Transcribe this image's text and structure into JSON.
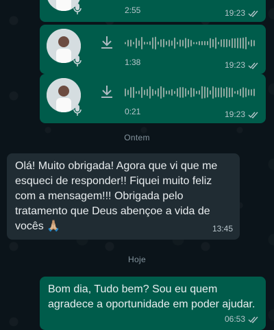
{
  "voice_messages": [
    {
      "duration": "2:55",
      "time": "19:23"
    },
    {
      "duration": "1:38",
      "time": "19:23"
    },
    {
      "duration": "0:21",
      "time": "19:23"
    }
  ],
  "dividers": {
    "yesterday": "Ontem",
    "today": "Hoje"
  },
  "incoming": {
    "text": "Olá! Muito obrigada! Agora que vi que me esqueci de responder!! Fiquei muito feliz com a mensagem!!! Obrigada pelo tratamento que Deus abençoe a vida de vocês 🙏🏼",
    "time": "13:45"
  },
  "outgoing": {
    "text": "Bom dia,                    Tudo bem? Sou eu quem agradece a oportunidade em poder ajudar.",
    "time": "06:53"
  },
  "icons": {
    "read": "double-check-icon",
    "download": "download-icon",
    "mic": "mic-icon"
  },
  "colors": {
    "out_bubble": "#005c4b",
    "in_bubble": "#202c33",
    "read_tick": "#b9c6cc"
  }
}
